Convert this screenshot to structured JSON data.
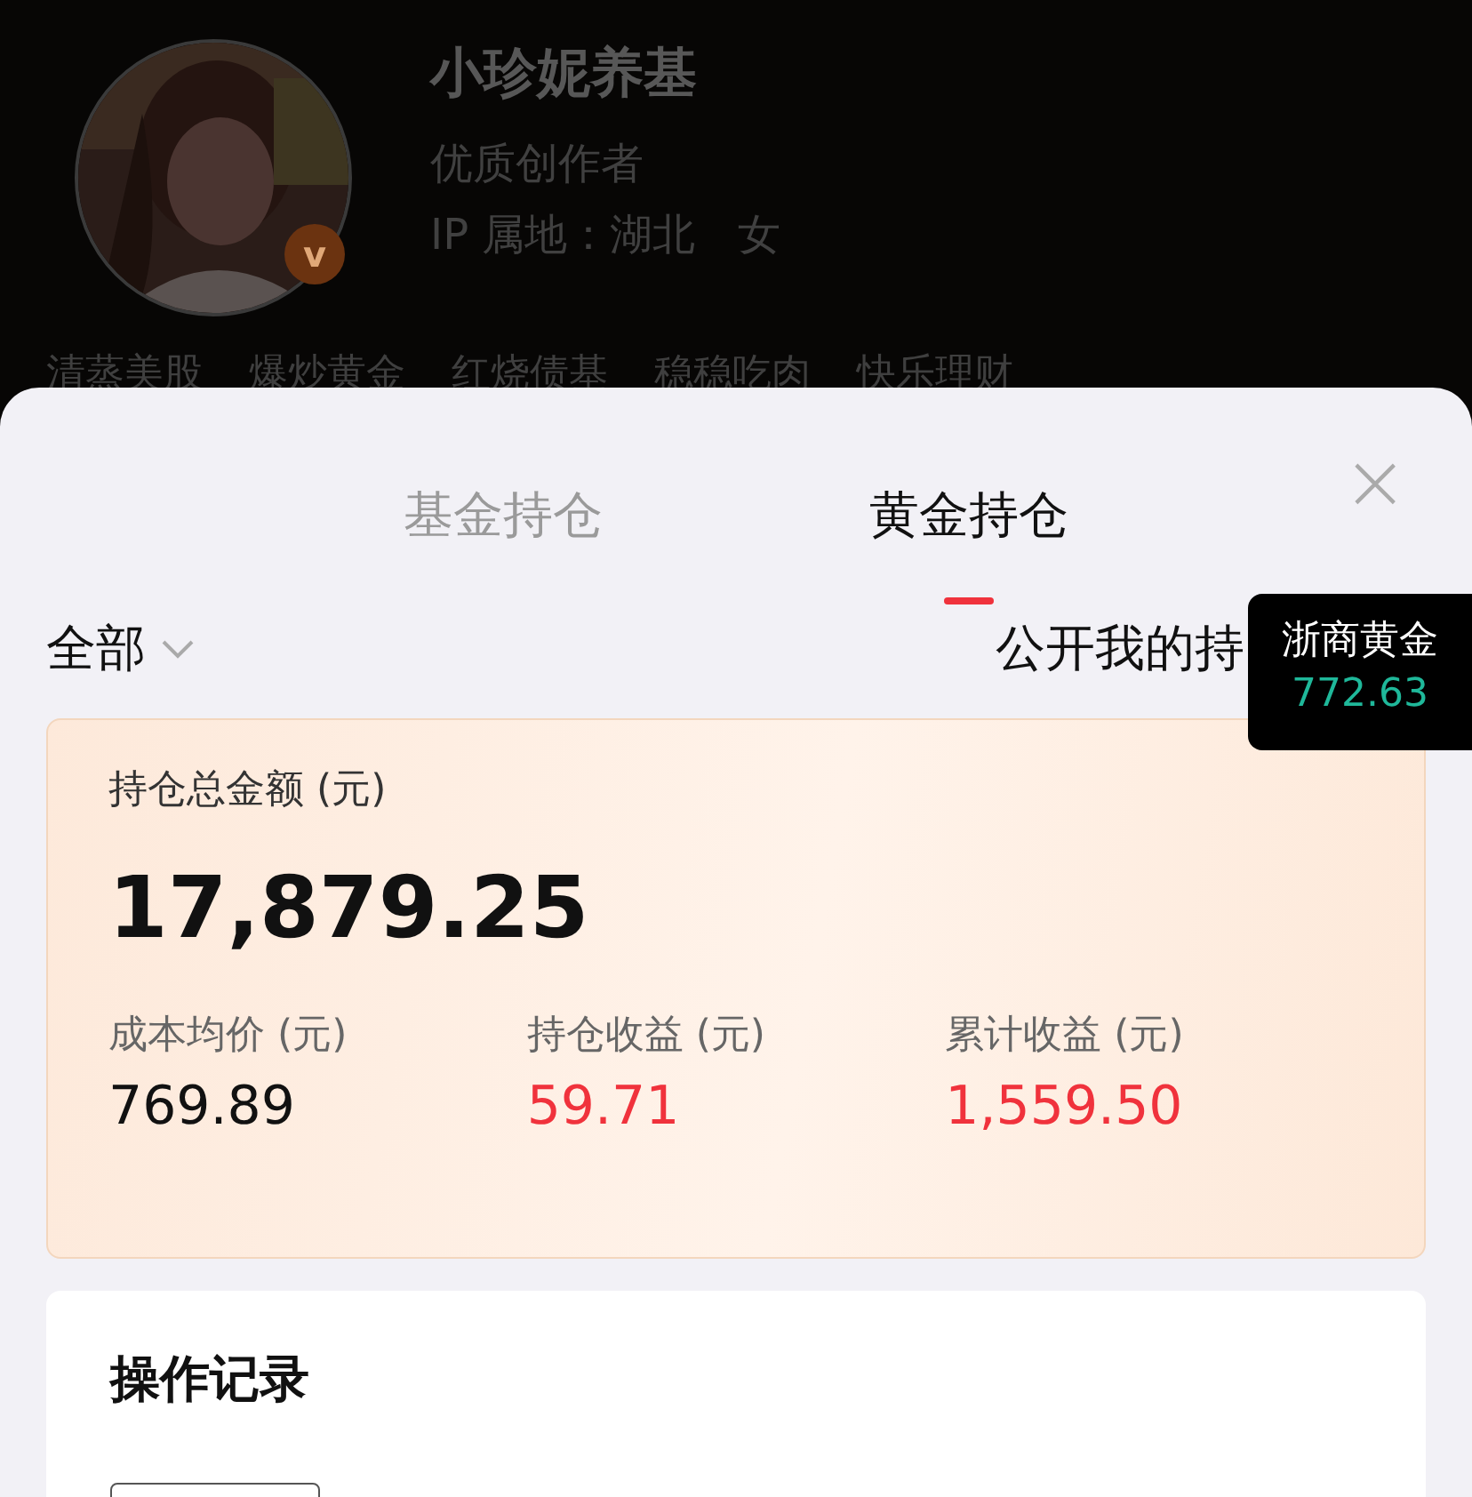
{
  "profile": {
    "name": "小珍妮养基",
    "title": "优质创作者",
    "ip_location": "IP 属地：湖北",
    "gender": "女",
    "verified_badge": "v"
  },
  "tags": [
    "清蒸美股",
    "爆炒黄金",
    "红烧债基",
    "稳稳吃肉",
    "快乐理财"
  ],
  "tabs": [
    {
      "label": "基金持仓",
      "selected": false
    },
    {
      "label": "黄金持仓",
      "selected": true
    }
  ],
  "close": "×",
  "filter": {
    "label": "全部"
  },
  "public_toggle": {
    "label": "公开我的持"
  },
  "tooltip": {
    "name": "浙商黄金",
    "price": "772.63"
  },
  "summary": {
    "total_label": "持仓总金额 (元)",
    "total": "17,879.25",
    "stats": [
      {
        "label": "成本均价 (元)",
        "value": "769.89",
        "color": "#111111"
      },
      {
        "label": "持仓收益 (元)",
        "value": "59.71",
        "color": "#f0323c"
      },
      {
        "label": "累计收益 (元)",
        "value": "1,559.50",
        "color": "#f0323c"
      }
    ]
  },
  "records": {
    "title": "操作记录"
  }
}
